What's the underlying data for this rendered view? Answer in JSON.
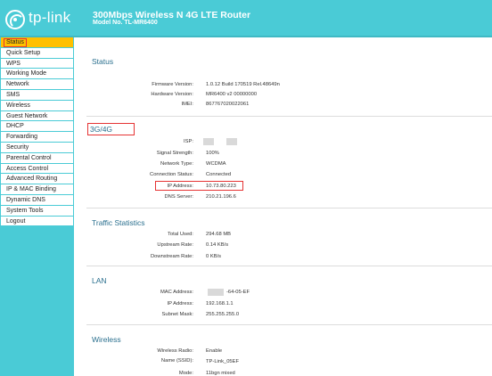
{
  "header": {
    "logo_text": "tp-link",
    "title": "300Mbps Wireless N 4G LTE Router",
    "model": "Model No. TL-MR6400"
  },
  "sidebar": {
    "items": [
      {
        "label": "Status",
        "active": true
      },
      {
        "label": "Quick Setup"
      },
      {
        "label": "WPS"
      },
      {
        "label": "Working Mode"
      },
      {
        "label": "Network"
      },
      {
        "label": "SMS"
      },
      {
        "label": "Wireless"
      },
      {
        "label": "Guest Network"
      },
      {
        "label": "DHCP"
      },
      {
        "label": "Forwarding"
      },
      {
        "label": "Security"
      },
      {
        "label": "Parental Control"
      },
      {
        "label": "Access Control"
      },
      {
        "label": "Advanced Routing"
      },
      {
        "label": "IP & MAC Binding"
      },
      {
        "label": "Dynamic DNS"
      },
      {
        "label": "System Tools"
      },
      {
        "label": "Logout"
      }
    ]
  },
  "status": {
    "title": "Status",
    "rows": [
      {
        "label": "Firmware Version:",
        "value": "1.0.12 Build 170519 Rel.48649n"
      },
      {
        "label": "Hardware Version:",
        "value": "MR6400 v2 00000000"
      },
      {
        "label": "IMEI:",
        "value": "867767020022061"
      }
    ]
  },
  "g34": {
    "title": "3G/4G",
    "rows": [
      {
        "label": "ISP:",
        "value": ""
      },
      {
        "label": "Signal Strength:",
        "value": "100%"
      },
      {
        "label": "Network Type:",
        "value": "WCDMA"
      },
      {
        "label": "Connection Status:",
        "value": "Connected"
      },
      {
        "label": "IP Address:",
        "value": "10.73.80.223"
      },
      {
        "label": "DNS Server:",
        "value": "210.21.196.6"
      }
    ]
  },
  "traffic": {
    "title": "Traffic Statistics",
    "rows": [
      {
        "label": "Total Used:",
        "value": "294.68 MB"
      },
      {
        "label": "Upstream Rate:",
        "value": "0.14 KB/s"
      },
      {
        "label": "Downstream Rate:",
        "value": "0 KB/s"
      }
    ]
  },
  "lan": {
    "title": "LAN",
    "rows": [
      {
        "label": "MAC Address:",
        "value": "-64-05-EF"
      },
      {
        "label": "IP Address:",
        "value": "192.168.1.1"
      },
      {
        "label": "Subnet Mask:",
        "value": "255.255.255.0"
      }
    ]
  },
  "wireless": {
    "title": "Wireless",
    "rows": [
      {
        "label": "Wireless Radio:",
        "value": "Enable"
      },
      {
        "label": "Name (SSID):",
        "value": "TP-Link_05EF"
      },
      {
        "label": "Mode:",
        "value": "11bgn mixed"
      }
    ]
  },
  "colors": {
    "brand": "#4acbd6",
    "active_menu": "#ffc000",
    "highlight": "#e53333",
    "section_title": "#2a6f8e"
  }
}
